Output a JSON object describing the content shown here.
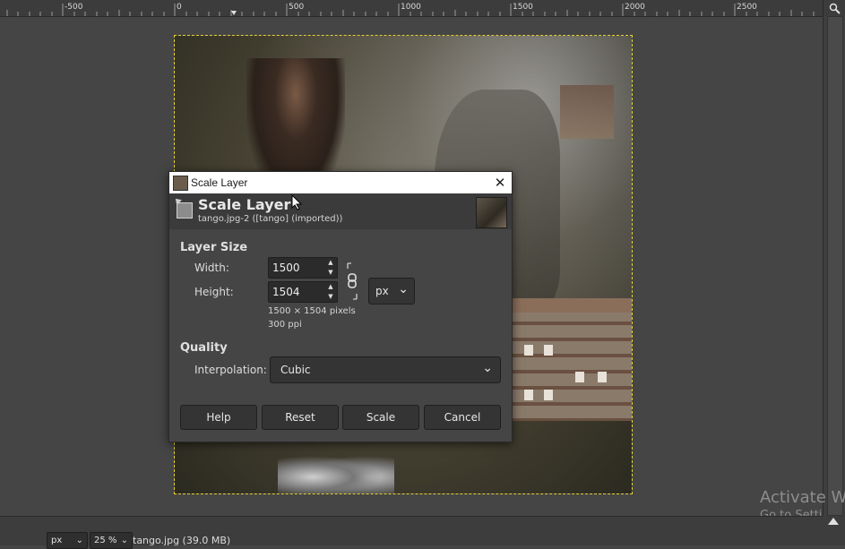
{
  "ruler": {
    "labels": [
      "-500",
      "0",
      "500",
      "1000",
      "1500",
      "2000",
      "2500"
    ]
  },
  "dialog": {
    "window_title": "Scale Layer",
    "close_glyph": "✕",
    "header_title": "Scale Layer",
    "header_subtitle": "tango.jpg-2 ([tango] (imported))",
    "layer_size_label": "Layer Size",
    "width_label": "Width:",
    "width_value": "1500",
    "height_label": "Height:",
    "height_value": "1504",
    "unit_value": "px",
    "pixels_info": "1500 × 1504 pixels",
    "ppi_info": "300 ppi",
    "quality_label": "Quality",
    "interpolation_label": "Interpolation:",
    "interpolation_value": "Cubic",
    "buttons": {
      "help": "Help",
      "reset": "Reset",
      "scale": "Scale",
      "cancel": "Cancel"
    }
  },
  "statusbar": {
    "unit": "px",
    "zoom": "25 %",
    "filename": "tango.jpg (39.0 MB)"
  },
  "watermark": {
    "line1": "Activate W",
    "line2": "Go to Setti"
  },
  "icons": {
    "zoom": "magnifier-icon",
    "chain": "chain-link-icon",
    "chevron": "chevron-down-icon",
    "close": "close-icon"
  }
}
